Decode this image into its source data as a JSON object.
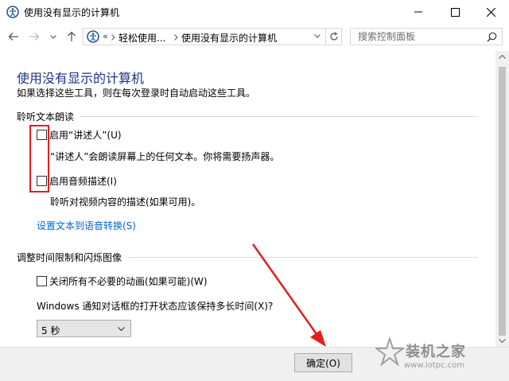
{
  "window": {
    "title": "使用没有显示的计算机",
    "controls": [
      "minimize",
      "maximize",
      "close"
    ]
  },
  "nav": {
    "breadcrumb_overflow": "«",
    "breadcrumb": [
      "轻松使用...",
      "使用没有显示的计算机"
    ],
    "search_placeholder": "搜索控制面板"
  },
  "main": {
    "title": "使用没有显示的计算机",
    "description": "如果选择这些工具，则在每次登录时自动启动这些工具。",
    "section1": {
      "heading": "聆听文本朗读",
      "options": [
        {
          "label": "启用“讲述人”(U)",
          "checked": false,
          "note": "“讲述人”会朗读屏幕上的任何文本。你将需要扬声器。"
        },
        {
          "label": "启用音频描述(I)",
          "checked": false,
          "note": "聆听对视频内容的描述(如果可用)。"
        }
      ],
      "link": "设置文本到语音转换(S)"
    },
    "section2": {
      "heading": "调整时间限制和闪烁图像",
      "option": {
        "label": "关闭所有不必要的动画(如果可能)(W)",
        "checked": false
      },
      "question": "Windows 通知对话框的打开状态应该保持多长时间(X)?",
      "select_value": "5 秒"
    }
  },
  "footer": {
    "ok_label": "确定(O)"
  },
  "watermark": {
    "text": "装机之家",
    "url": "www.lotpc.com"
  },
  "colors": {
    "title_blue": "#1e3287",
    "link_blue": "#0066cc",
    "annotation_red": "#e41e1e"
  }
}
